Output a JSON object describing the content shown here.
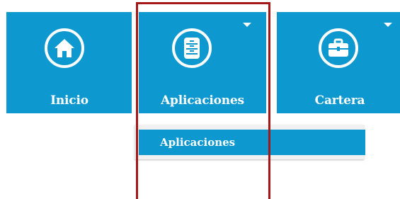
{
  "colors": {
    "tile": "#0e98d0",
    "highlight": "#a61717",
    "dropdown_bg": "#f1f1f1"
  },
  "tiles": [
    {
      "label": "Inicio",
      "icon": "home-icon",
      "has_dropdown": false
    },
    {
      "label": "Aplicaciones",
      "icon": "server-rack-icon",
      "has_dropdown": true
    },
    {
      "label": "Cartera",
      "icon": "briefcase-icon",
      "has_dropdown": true
    }
  ],
  "dropdown": {
    "items": [
      {
        "label": "Aplicaciones"
      }
    ]
  }
}
